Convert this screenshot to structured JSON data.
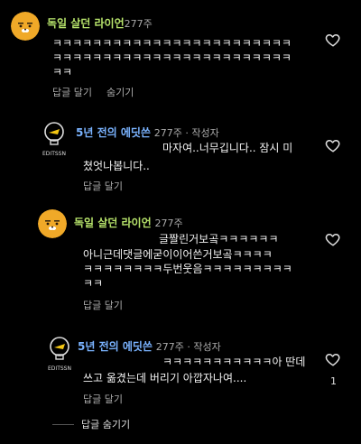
{
  "comments": [
    {
      "author": "독일 살던 라이언",
      "meta": "277주",
      "lines": [
        "ㅋㅋㅋㅋㅋㅋㅋㅋㅋㅋㅋㅋㅋㅋㅋㅋㅋㅋㅋㅋㅋㅋㅋㅋ",
        "ㅋㅋㅋㅋㅋㅋㅋㅋㅋㅋㅋㅋㅋㅋㅋㅋㅋㅋㅋㅋㅋㅋㅋㅋ",
        "ㅋㅋ"
      ],
      "actions": [
        "답글 달기",
        "숨기기"
      ]
    },
    {
      "author": "5년 전의 에딧쓴",
      "meta": "277주 · 작성자",
      "lines": [
        "마자여..너무깁니다.. 잠시 미",
        "쳤엇나봅니다.."
      ],
      "actions": [
        "답글 달기"
      ],
      "avatar_text": "EDITSSN"
    },
    {
      "author": "독일 살던 라이언",
      "meta": "277주",
      "lines": [
        "글짤린거보곸ㅋㅋㅋㅋㅋㅋ",
        "아니근데댓글에굳이이어쓴거보곸ㅋㅋㅋㅋ",
        "ㅋㅋㅋㅋㅋㅋㅋㅋ두번웃음ㅋㅋㅋㅋㅋㅋㅋㅋㅋ",
        "ㅋㅋ"
      ],
      "actions": [
        "답글 달기"
      ]
    },
    {
      "author": "5년 전의 에딧쓴",
      "meta": "277주 · 작성자",
      "lines": [
        "ㅋㅋㅋㅋㅋㅋㅋㅋㅋㅋㅋ아 딴데",
        "쓰고 옮겼는데 버리기 아깝자나여...."
      ],
      "actions": [
        "답글 달기"
      ],
      "likes": "1",
      "avatar_text": "EDITSSN"
    }
  ],
  "collapse_label": "답글 숨기기",
  "colors": {
    "background": "#000000",
    "author_green": "#b7e36b",
    "author_blue": "#7ab3ff",
    "meta": "#aaaaaa"
  }
}
